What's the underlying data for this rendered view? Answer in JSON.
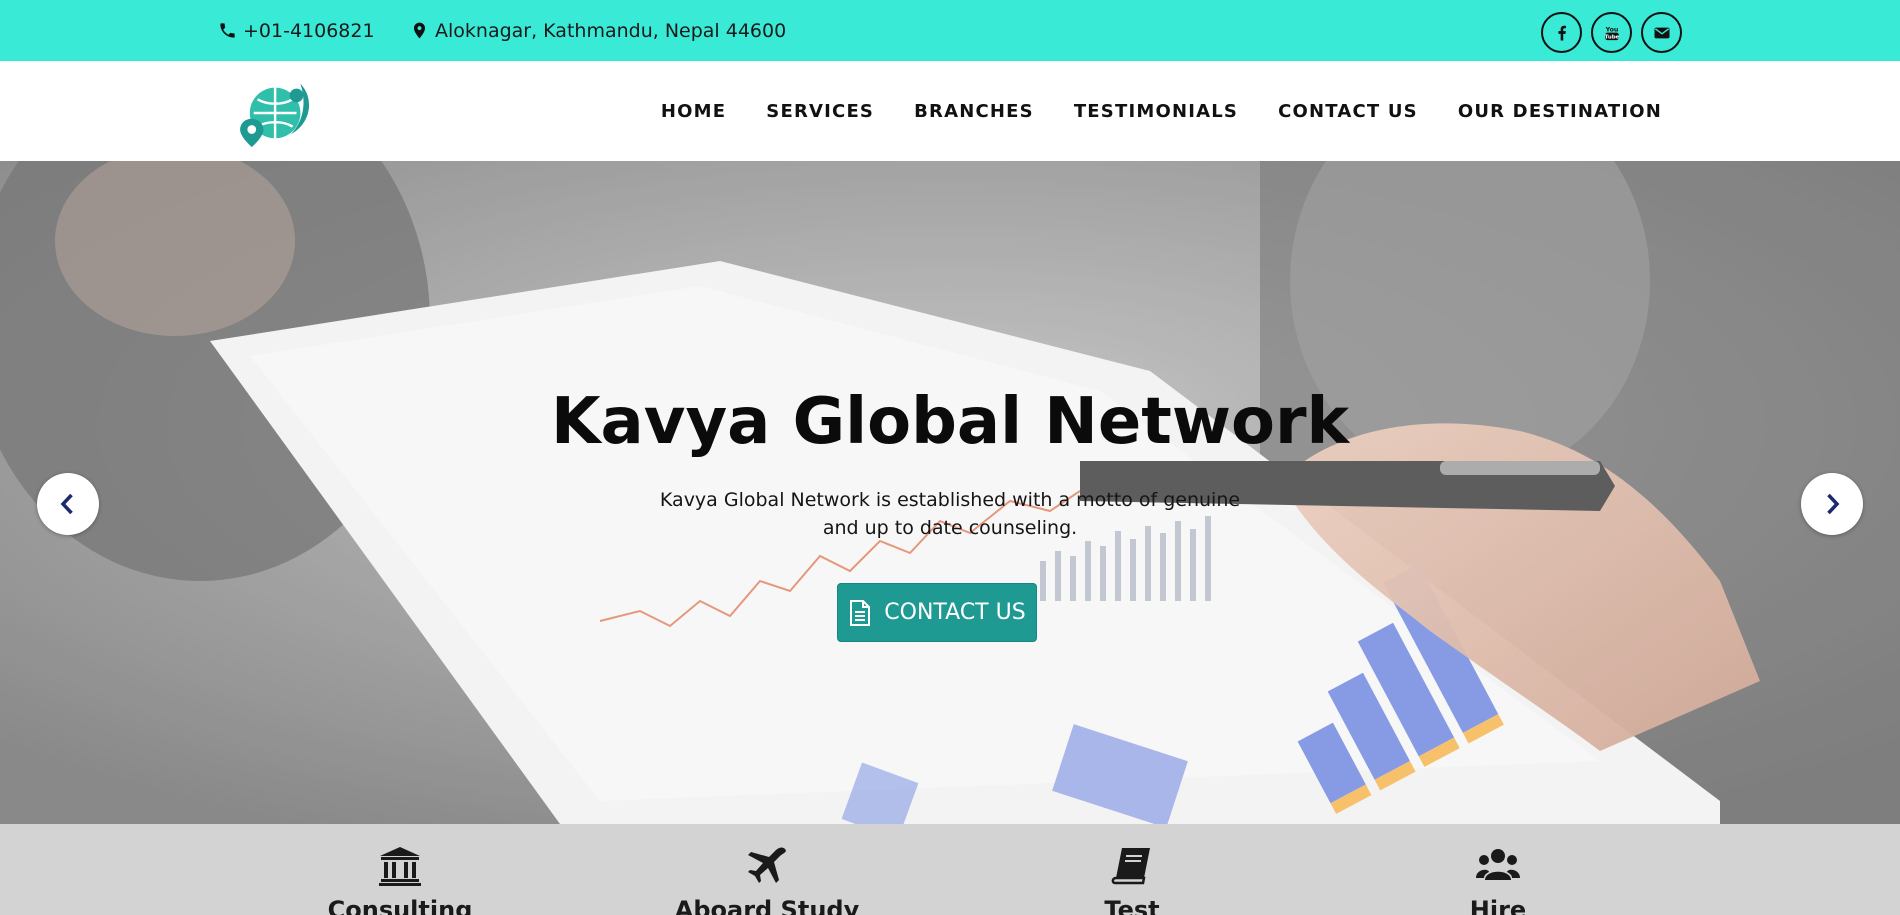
{
  "topbar": {
    "phone": "+01-4106821",
    "address": "Aloknagar, Kathmandu, Nepal 44600",
    "background": "#39ebd6",
    "socials": [
      {
        "icon": "facebook-icon"
      },
      {
        "icon": "youtube-icon"
      },
      {
        "icon": "envelope-icon"
      }
    ]
  },
  "nav": {
    "items": [
      "HOME",
      "SERVICES",
      "BRANCHES",
      "TESTIMONIALS",
      "CONTACT US",
      "OUR DESTINATION"
    ]
  },
  "hero": {
    "title": "Kavya Global Network",
    "subtitle": "Kavya Global Network is established with a motto of genuine and up to date counseling.",
    "button_label": "CONTACT US",
    "button_icon": "document-icon",
    "button_color": "#1f9a93",
    "prev_icon": "chevron-left-icon",
    "next_icon": "chevron-right-icon"
  },
  "services": {
    "background": "#d3d3d3",
    "items": [
      {
        "label": "Consulting",
        "icon": "bank-icon"
      },
      {
        "label": "Aboard Study",
        "icon": "plane-icon"
      },
      {
        "label": "Test",
        "icon": "book-icon"
      },
      {
        "label": "Hire",
        "icon": "users-icon"
      }
    ]
  }
}
